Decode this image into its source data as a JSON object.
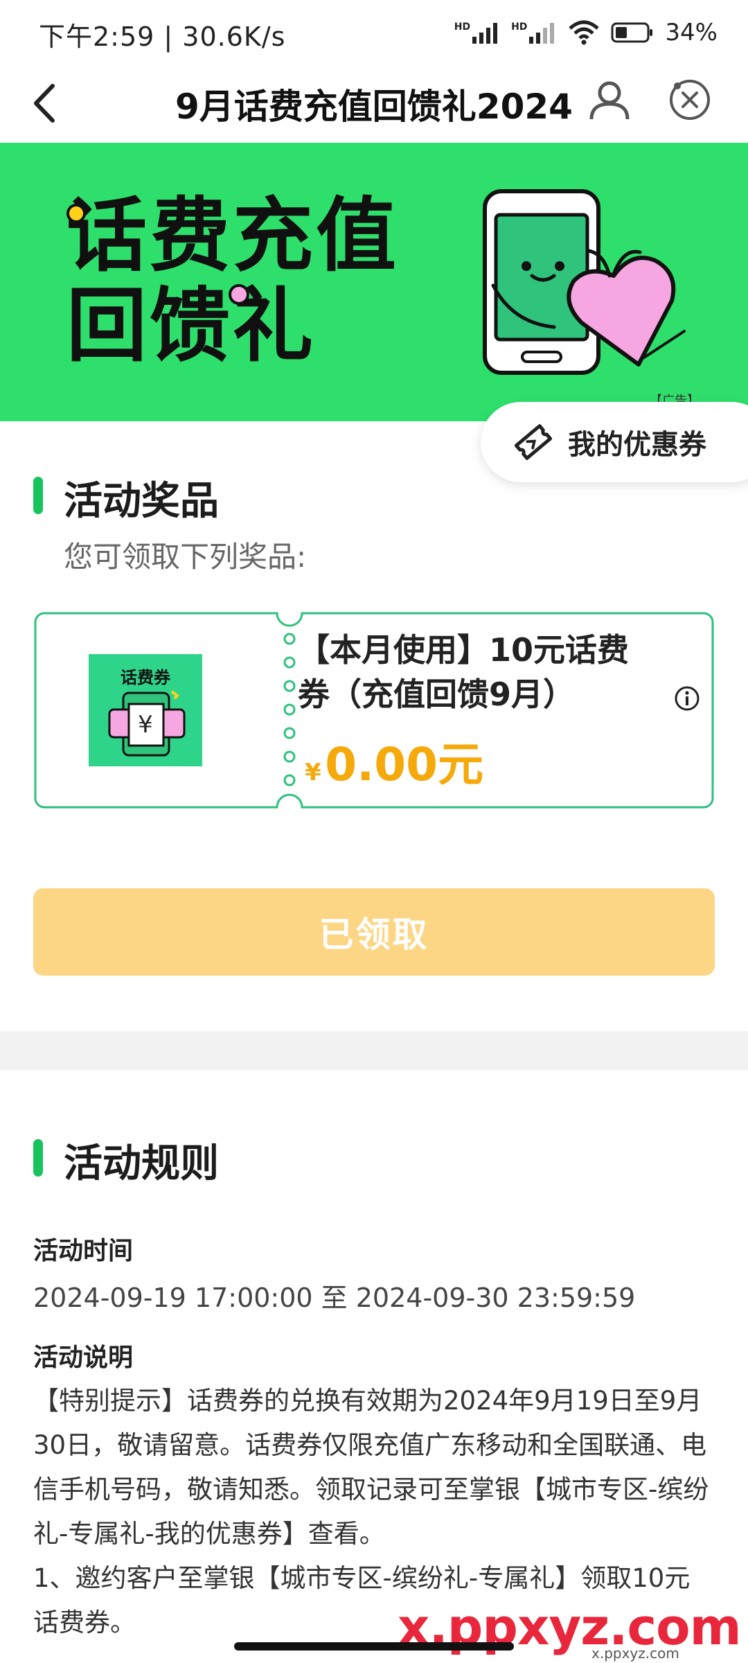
{
  "status_bar": {
    "time_speed": "下午2:59 | 30.6K/s",
    "network_hd1": "HD",
    "network_hd2": "HD",
    "battery": "34%"
  },
  "nav": {
    "title": "9月话费充值回馈礼2024",
    "back_icon": "chevron-left-icon",
    "user_icon": "user-icon",
    "close_icon": "close-circle-icon"
  },
  "banner": {
    "line1": "话费充值",
    "line2": "回馈礼",
    "ad_tag": "【广告】",
    "colors": {
      "bg": "#2ee06b",
      "phone": "#2fc37b",
      "heart": "#f6a6e0"
    }
  },
  "my_coupon": {
    "label": "我的优惠券",
    "icon": "ticket-icon"
  },
  "prizes": {
    "title": "活动奖品",
    "subtitle": "您可领取下列奖品:",
    "card": {
      "image_label": "话费券",
      "yen_symbol": "¥",
      "title": "【本月使用】10元话费券（充值回馈9月）",
      "currency": "¥",
      "price": "0.00元"
    },
    "button": "已领取"
  },
  "rules": {
    "title": "活动规则",
    "time_label": "活动时间",
    "time_value": "2024-09-19 17:00:00 至 2024-09-30 23:59:59",
    "desc_label": "活动说明",
    "desc_1": "【特别提示】话费券的兑换有效期为2024年9月19日至9月30日，敬请留意。话费券仅限充值广东移动和全国联通、电信手机号码，敬请知悉。领取记录可至掌银【城市专区-缤纷礼-专属礼-我的优惠券】查看。",
    "desc_2": "1、邀约客户至掌银【城市专区-缤纷礼-专属礼】领取10元话费券。"
  },
  "watermark": {
    "text": "x.ppxyz.com",
    "sub": "x.ppxyz.com"
  },
  "colors": {
    "accent": "#18c35d",
    "price": "#f5a90b",
    "button_disabled": "#fcd684"
  }
}
